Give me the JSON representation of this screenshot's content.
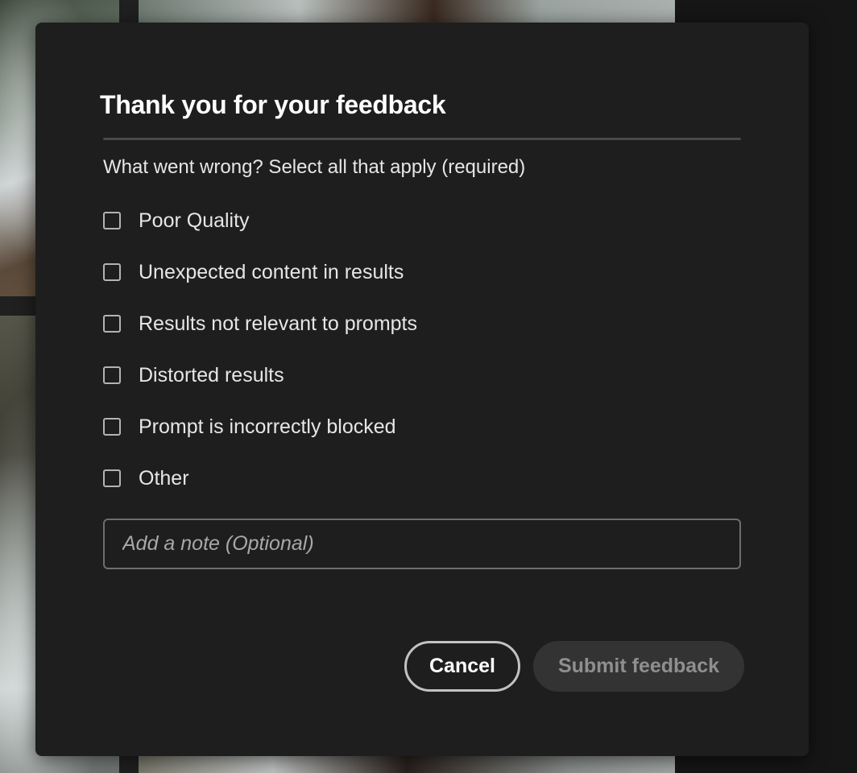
{
  "dialog": {
    "title": "Thank you for your feedback",
    "question": "What went wrong? Select all that apply (required)",
    "options": [
      {
        "label": "Poor Quality",
        "checked": false
      },
      {
        "label": "Unexpected content in results",
        "checked": false
      },
      {
        "label": "Results not relevant to prompts",
        "checked": false
      },
      {
        "label": "Distorted results",
        "checked": false
      },
      {
        "label": "Prompt is incorrectly blocked",
        "checked": false
      },
      {
        "label": "Other",
        "checked": false
      }
    ],
    "note": {
      "placeholder": "Add a note (Optional)",
      "value": ""
    },
    "buttons": {
      "cancel": "Cancel",
      "submit": "Submit feedback"
    }
  },
  "colors": {
    "dialog_background": "#1e1e1e",
    "text_primary": "#ffffff",
    "text_secondary": "#e6e6e6",
    "submit_disabled_background": "#333333",
    "submit_disabled_text": "#8f8f8f"
  }
}
